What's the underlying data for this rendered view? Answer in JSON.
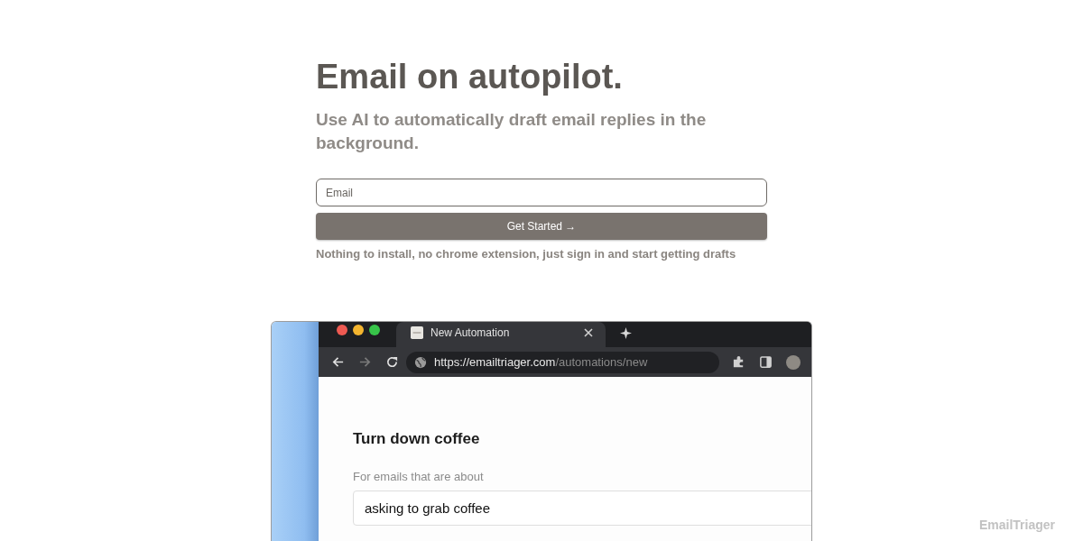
{
  "hero": {
    "title": "Email on autopilot.",
    "subtitle": "Use AI to automatically draft email replies in the background."
  },
  "signup": {
    "email_field": {
      "placeholder": "Email"
    },
    "button": "Get Started →",
    "note": "Nothing to install, no chrome extension, just sign in and start getting drafts"
  },
  "preview": {
    "tab": {
      "title": "New Automation",
      "selected": true
    },
    "address_bar": {
      "url_host": "https://emailtriager.com",
      "url_path": "/automations/new"
    },
    "page": {
      "heading": "Turn down coffee",
      "field_label": "For emails that are about",
      "field_value": "asking to grab coffee"
    }
  },
  "brand": "EmailTriager"
}
